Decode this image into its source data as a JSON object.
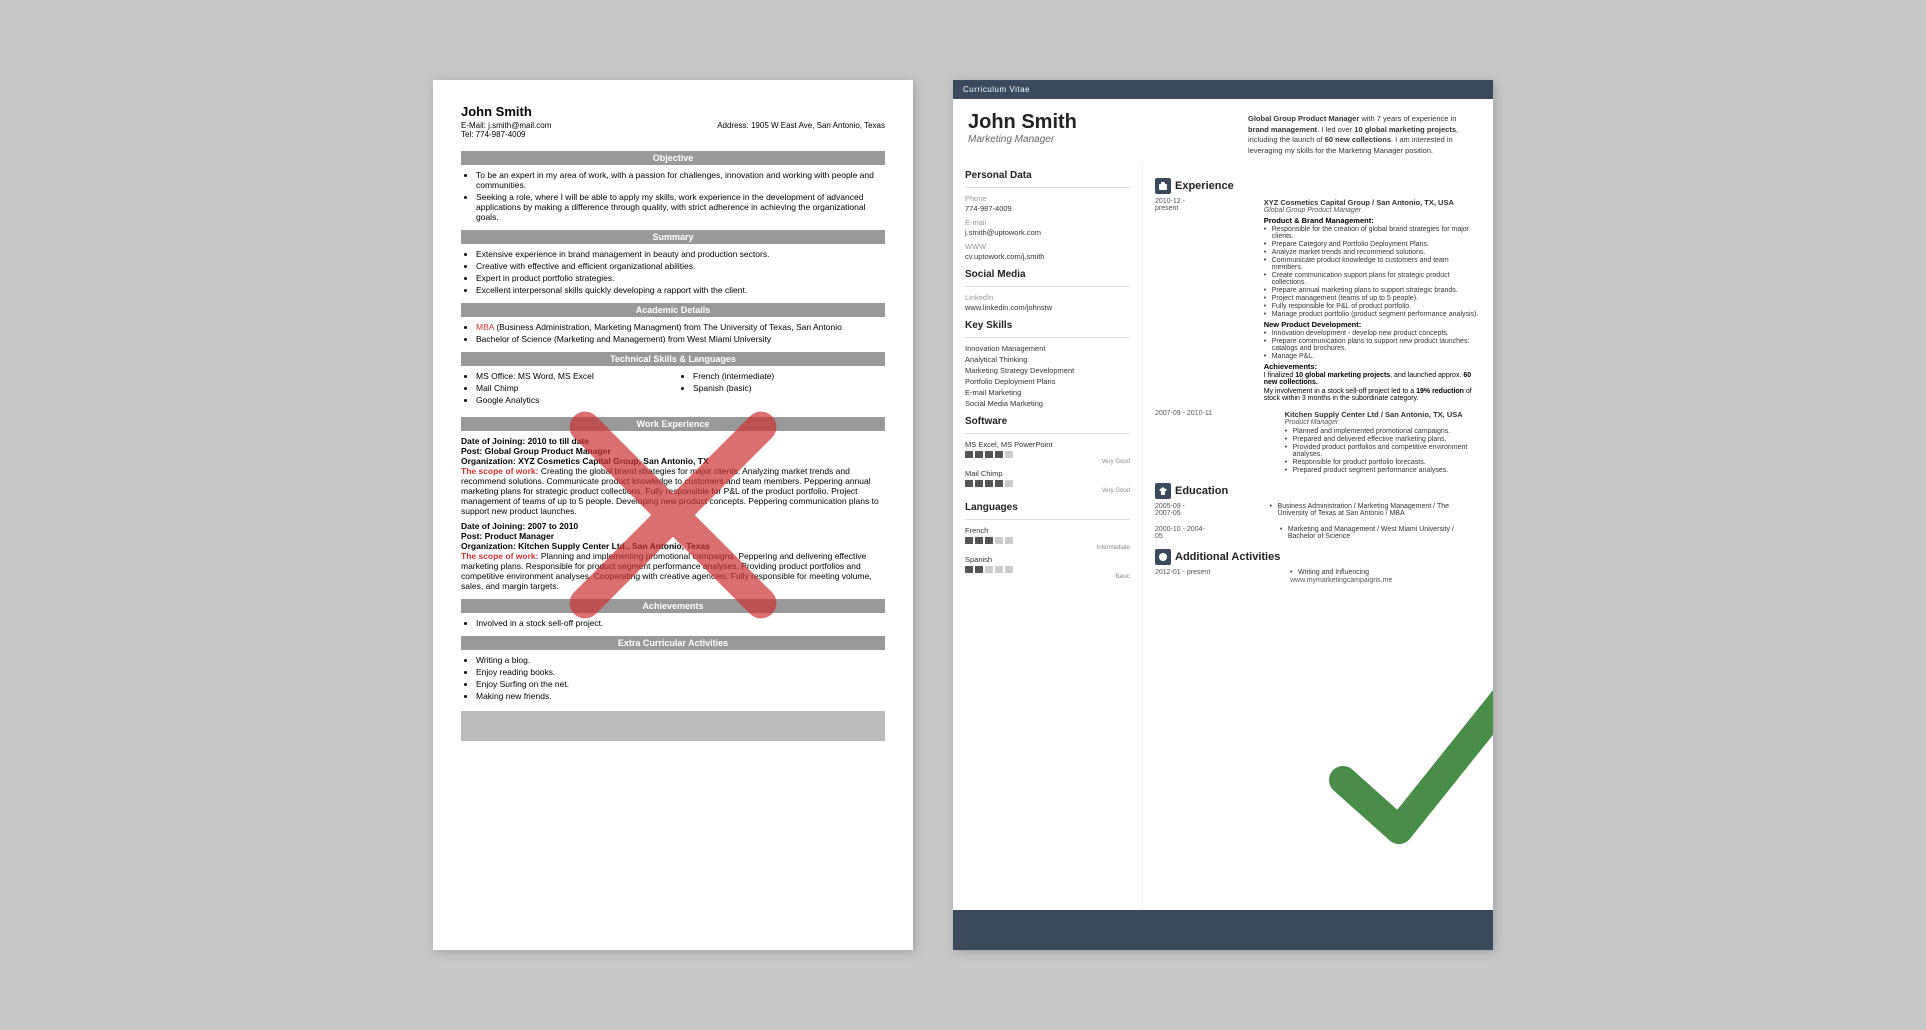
{
  "left_resume": {
    "name": "John Smith",
    "email": "E-Mail: j.smith@mail.com",
    "address": "Address: 1905 W East Ave, San Antonio, Texas",
    "phone": "Tel: 774-987-4009",
    "objective_header": "Objective",
    "objective_bullets": [
      "To be an expert in my area of work, with a passion for challenges, innovation and working with people and communities.",
      "Seeking a role, where I will be able to apply my skills, work experience in the development of advanced applications by making a difference through quality, with strict adherence in achieving the organizational goals."
    ],
    "summary_header": "Summary",
    "summary_bullets": [
      "Extensive experience in brand management in beauty and production sectors.",
      "Creative with effective and efficient organizational abilities.",
      "Expert in product portfolio strategies.",
      "Excellent interpersonal skills quickly developing a rapport with the client."
    ],
    "academic_header": "Academic Details",
    "academic_bullets": [
      "MBA (Business Administration, Marketing Managment) from The University of Texas, San Antonio",
      "Bachelor of Science (Marketing and Management) from West Miami University"
    ],
    "technical_header": "Technical Skills & Languages",
    "skills_col1": [
      "MS Office: MS Word, MS Excel",
      "Mail Chimp",
      "Google Analytics"
    ],
    "skills_col2": [
      "French (intermediate)",
      "Spanish (basic)"
    ],
    "work_header": "Work Experience",
    "job1_dates": "Date of Joining: 2010 to till date",
    "job1_post": "Post: Global Group Product Manager",
    "job1_org": "Organization: XYZ Cosmetics Capital Group, San Antonio, TX",
    "job1_scope_label": "The scope of work:",
    "job1_scope": "Creating the global brand strategies for major clients. Analyzing market trends and recommend solutions. Communicate product knowledge to customers and team members. Peppering annual marketing plans for strategic product collections. Fully responsible for P&L of the product portfolio. Project management of teams of up to 5 people. Developing new product concepts. Peppering communication plans to support new product launches.",
    "job2_dates": "Date of Joining: 2007 to 2010",
    "job2_post": "Post: Product Manager",
    "job2_org": "Organization: Kitchen Supply Center Ltd., San Antonio, Texas",
    "job2_scope_label": "The scope of work:",
    "job2_scope": "Planning and implementing promotional campaigns. Peppering and delivering effective marketing plans. Responsible for product segment performance analyses. Providing product portfolios and competitive environment analyses. Cooperating with creative agencies. Fully responsible for meeting volume, sales, and margin targets.",
    "achievements_header": "Achievements",
    "achievements_bullets": [
      "Involved in a stock sell-off project."
    ],
    "extra_header": "Extra Curricular Activities",
    "extra_bullets": [
      "Writing a blog.",
      "Enjoy reading books.",
      "Enjoy Surfing on the net.",
      "Making new friends."
    ]
  },
  "right_resume": {
    "cv_label": "Curriculum Vitae",
    "name": "John Smith",
    "title": "Marketing Manager",
    "personal_data_header": "Personal Data",
    "phone_label": "Phone",
    "phone": "774-987-4009",
    "email_label": "E-mail",
    "email": "j.smith@uptowork.com",
    "www_label": "WWW",
    "www": "cv.uptowork.com/j.smith",
    "social_media_header": "Social Media",
    "linkedin_label": "LinkedIn",
    "linkedin": "www.linkedin.com/johnstw",
    "key_skills_header": "Key Skills",
    "key_skills": [
      "Innovation Management",
      "Analytical Thinking",
      "Marketing Strategy Development",
      "Portfolio Deployment Plans",
      "E-mail Marketing",
      "Social Media Marketing"
    ],
    "software_header": "Software",
    "software": [
      {
        "name": "MS Excel, MS PowerPoint",
        "level": 4,
        "label": "Very Good"
      },
      {
        "name": "Mail Chimp",
        "level": 4,
        "label": "Very Good"
      }
    ],
    "languages_header": "Languages",
    "languages": [
      {
        "name": "French",
        "level": 3,
        "label": "Intermediate"
      },
      {
        "name": "Spanish",
        "level": 2,
        "label": "Basic"
      }
    ],
    "profile_summary": "Global Group Product Manager with 7 years of experience in brand management. I led over 10 global marketing projects, including the launch of 60 new collections. I am interested in leveraging my skills for the Marketing Manager position.",
    "experience_header": "Experience",
    "experiences": [
      {
        "dates": "2010-12 - present",
        "company": "XYZ Cosmetics Capital Group / San Antonio, TX, USA",
        "role": "Global Group Product Manager",
        "sections": [
          {
            "subtitle": "Product & Brand Management:",
            "bullets": [
              "Responsible for the creation of global brand strategies for major clients.",
              "Prepare Category and Portfolio Deployment Plans.",
              "Analyze market trends and recommend solutions.",
              "Communicate product knowledge to customers and team members.",
              "Create communication support plans for strategic product collections.",
              "Prepare annual marketing plans to support strategic brands.",
              "Project management (teams of up to 5 people).",
              "Fully responsible for P&L of product portfolio.",
              "Manage product portfolio (product segment performance analysis)."
            ]
          },
          {
            "subtitle": "New Product Development:",
            "bullets": [
              "Innovation development - develop new product concepts.",
              "Prepare communication plans to support new product launches: catalogs and brochures.",
              "Manage P&L."
            ]
          },
          {
            "subtitle": "Achievements:",
            "text": "I finalized 10 global marketing projects, and launched approx. 60 new collections.",
            "text2": "My involvement in a stock sell-off project led to a 19% reduction of stock within 3 months in the subordinate category."
          }
        ]
      },
      {
        "dates": "2007-09 - 2010-11",
        "company": "Kitchen Supply Center Ltd / San Antonio, TX, USA",
        "role": "Product Manager",
        "bullets": [
          "Planned and implemented promotional campaigns.",
          "Prepared and delivered effective marketing plans.",
          "Provided product portfolios and competitive environment analyses.",
          "Responsible for product portfolio forecasts.",
          "Prepared product segment performance analyses."
        ]
      }
    ],
    "education_header": "Education",
    "education": [
      {
        "dates": "2005-09 - 2007-05",
        "degree": "Business Administration / Marketing Management / The University of Texas at San Antonio / MBA"
      },
      {
        "dates": "2000-10 - 2004-05",
        "degree": "Marketing and Management / West Miami University / Bachelor of Science"
      }
    ],
    "additional_header": "Additional Activities",
    "additional": [
      {
        "dates": "2012-01 - present",
        "description": "Writing and Influencing",
        "url": "www.mymarketingcampaigns.me"
      }
    ]
  }
}
